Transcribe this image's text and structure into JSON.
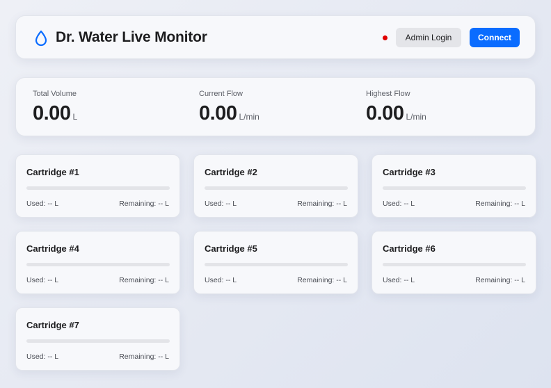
{
  "header": {
    "title": "Dr. Water Live Monitor",
    "logo_icon": "water-drop-icon",
    "status_color": "#e00000",
    "admin_label": "Admin Login",
    "connect_label": "Connect"
  },
  "stats": [
    {
      "label": "Total Volume",
      "value": "0.00",
      "unit": "L"
    },
    {
      "label": "Current Flow",
      "value": "0.00",
      "unit": "L/min"
    },
    {
      "label": "Highest Flow",
      "value": "0.00",
      "unit": "L/min"
    }
  ],
  "cartridges": [
    {
      "title": "Cartridge #1",
      "used": "Used: -- L",
      "remaining": "Remaining: -- L",
      "usage_fraction": 0
    },
    {
      "title": "Cartridge #2",
      "used": "Used: -- L",
      "remaining": "Remaining: -- L",
      "usage_fraction": 0
    },
    {
      "title": "Cartridge #3",
      "used": "Used: -- L",
      "remaining": "Remaining: -- L",
      "usage_fraction": 0
    },
    {
      "title": "Cartridge #4",
      "used": "Used: -- L",
      "remaining": "Remaining: -- L",
      "usage_fraction": 0
    },
    {
      "title": "Cartridge #5",
      "used": "Used: -- L",
      "remaining": "Remaining: -- L",
      "usage_fraction": 0
    },
    {
      "title": "Cartridge #6",
      "used": "Used: -- L",
      "remaining": "Remaining: -- L",
      "usage_fraction": 0
    },
    {
      "title": "Cartridge #7",
      "used": "Used: -- L",
      "remaining": "Remaining: -- L",
      "usage_fraction": 0
    }
  ],
  "colors": {
    "accent": "#0a6cff",
    "status_offline": "#e00000"
  }
}
